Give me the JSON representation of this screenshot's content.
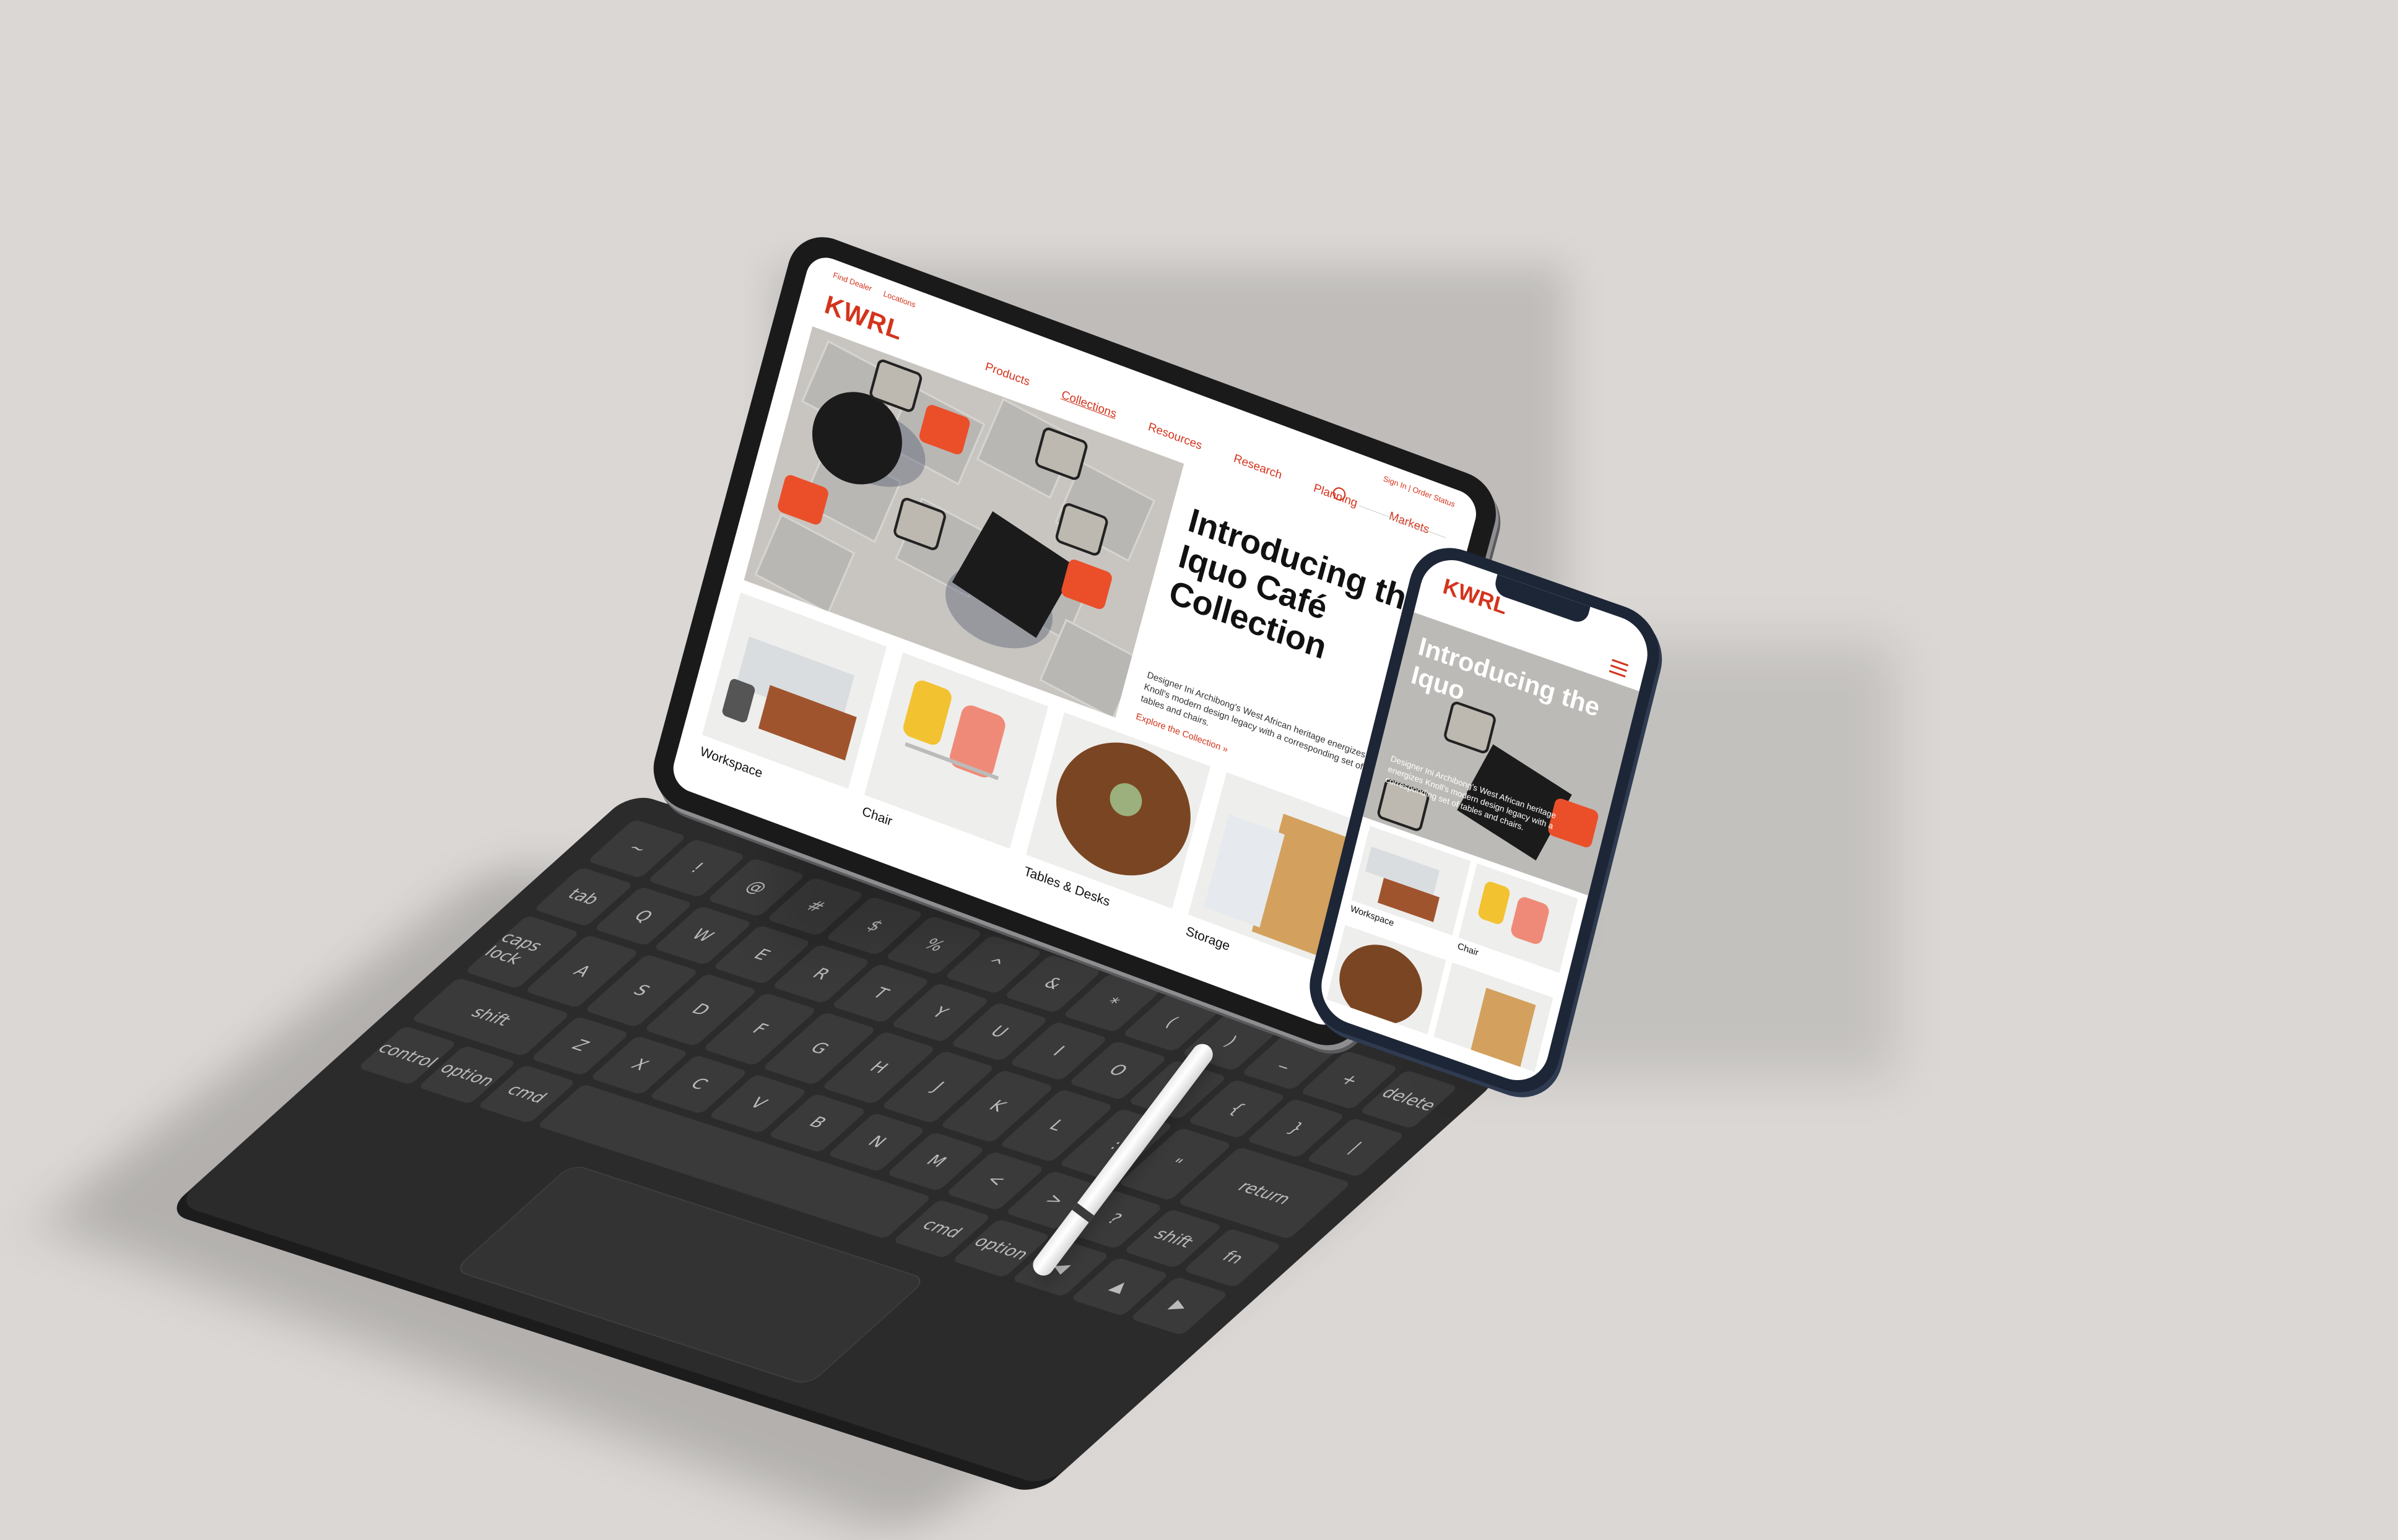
{
  "brand": {
    "logo_text": "KWRL",
    "accent_color": "#d3341d"
  },
  "tablet": {
    "utility_links": [
      "Find Dealer",
      "Locations"
    ],
    "account_links": [
      "Sign In",
      "Order Status"
    ],
    "nav": [
      {
        "label": "Products"
      },
      {
        "label": "Collections"
      },
      {
        "label": "Resources"
      },
      {
        "label": "Research"
      },
      {
        "label": "Planning"
      },
      {
        "label": "Markets"
      }
    ],
    "hero": {
      "title": "Introducing the Iquo Café Collection",
      "description": "Designer Ini Archibong's West African heritage energizes Knoll's modern design legacy with a corresponding set of tables and chairs.",
      "link": "Explore the Collection »"
    },
    "categories": [
      {
        "label": "Workspace"
      },
      {
        "label": "Chair"
      },
      {
        "label": "Tables & Desks"
      },
      {
        "label": "Storage"
      }
    ]
  },
  "phone": {
    "hero": {
      "title": "Introducing the Iquo",
      "description": "Designer Ini Archibong's West African heritage energizes Knoll's modern design legacy with a corresponding set of tables and chairs."
    },
    "categories": [
      {
        "label": "Workspace"
      },
      {
        "label": "Chair"
      },
      {
        "label": ""
      },
      {
        "label": ""
      }
    ]
  },
  "keyboard": {
    "row1": [
      "~",
      "!",
      "@",
      "#",
      "$",
      "%",
      "^",
      "&",
      "*",
      "(",
      ")",
      "_",
      "+",
      "delete"
    ],
    "row2": [
      "tab",
      "Q",
      "W",
      "E",
      "R",
      "T",
      "Y",
      "U",
      "I",
      "O",
      "P",
      "{",
      "}",
      "|"
    ],
    "row3": [
      "caps lock",
      "A",
      "S",
      "D",
      "F",
      "G",
      "H",
      "J",
      "K",
      "L",
      ":",
      "\"",
      "return"
    ],
    "row4": [
      "shift",
      "Z",
      "X",
      "C",
      "V",
      "B",
      "N",
      "M",
      "<",
      ">",
      "?",
      "shift"
    ],
    "row5": [
      "fn",
      "control",
      "option",
      "cmd",
      "",
      "cmd",
      "option",
      "◀",
      "▲",
      "▶"
    ]
  }
}
